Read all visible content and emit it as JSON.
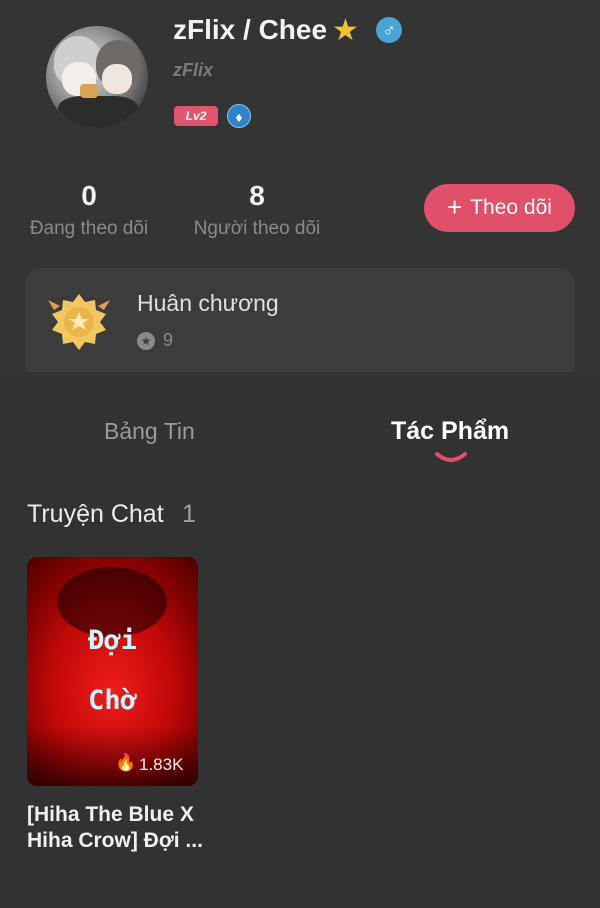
{
  "profile": {
    "name": "zFlix / Chee",
    "handle": "zFlix",
    "level": "Lv2",
    "star_icon": "star-icon",
    "gender_icon": "male-icon"
  },
  "stats": {
    "following_count": "0",
    "following_label": "Đang theo dõi",
    "followers_count": "8",
    "followers_label": "Người theo dõi"
  },
  "follow_button": {
    "icon": "+",
    "label": "Theo dõi"
  },
  "medals": {
    "title": "Huân chương",
    "count": "9"
  },
  "tabs": [
    {
      "label": "Bảng Tin",
      "active": false
    },
    {
      "label": "Tác Phẩm",
      "active": true
    }
  ],
  "section": {
    "title": "Truyện Chat",
    "count": "1"
  },
  "stories": [
    {
      "cover_text_1": "Đợi",
      "cover_text_2": "Chờ",
      "views": "1.83K",
      "title": "[Hiha The Blue X Hiha Crow] Đợi ..."
    }
  ],
  "colors": {
    "background": "#343434",
    "accent": "#e0506a",
    "text_muted": "#8a8a8a"
  }
}
